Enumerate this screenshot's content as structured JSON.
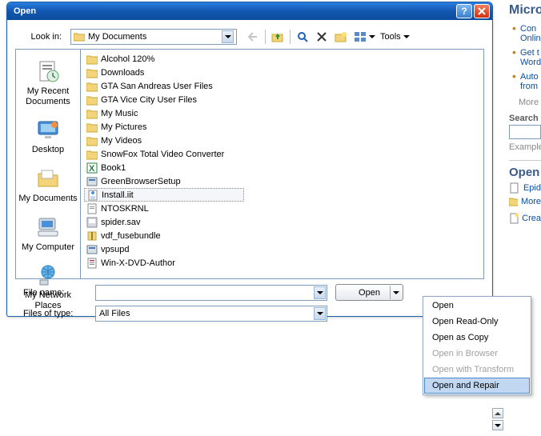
{
  "dialog": {
    "title": "Open",
    "lookin_label": "Look in:",
    "lookin_value": "My Documents",
    "tools_label": "Tools",
    "filename_label": "File name:",
    "filename_value": "",
    "filesoftype_label": "Files of type:",
    "filesoftype_value": "All Files",
    "open_button": "Open"
  },
  "places": [
    {
      "label": "My Recent Documents",
      "icon": "recent-docs-icon"
    },
    {
      "label": "Desktop",
      "icon": "desktop-icon"
    },
    {
      "label": "My Documents",
      "icon": "mydocs-icon"
    },
    {
      "label": "My Computer",
      "icon": "mycomputer-icon"
    },
    {
      "label": "My Network Places",
      "icon": "network-icon"
    }
  ],
  "files": [
    {
      "name": "Alcohol 120%",
      "type": "folder"
    },
    {
      "name": "Downloads",
      "type": "folder"
    },
    {
      "name": "GTA San Andreas User Files",
      "type": "folder"
    },
    {
      "name": "GTA Vice City User Files",
      "type": "folder"
    },
    {
      "name": "My Music",
      "type": "folder"
    },
    {
      "name": "My Pictures",
      "type": "folder"
    },
    {
      "name": "My Videos",
      "type": "folder"
    },
    {
      "name": "SnowFox Total Video Converter",
      "type": "folder"
    },
    {
      "name": "Book1",
      "type": "excel"
    },
    {
      "name": "GreenBrowserSetup",
      "type": "exe"
    },
    {
      "name": "Install.iit",
      "type": "iit",
      "selected": true
    },
    {
      "name": "NTOSKRNL",
      "type": "file"
    },
    {
      "name": "spider.sav",
      "type": "sav"
    },
    {
      "name": "vdf_fusebundle",
      "type": "zip"
    },
    {
      "name": "vpsupd",
      "type": "exe"
    },
    {
      "name": "Win-X-DVD-Author",
      "type": "richtext",
      "col2": true
    }
  ],
  "open_menu": {
    "items": [
      {
        "label": "Open",
        "enabled": true
      },
      {
        "label": "Open Read-Only",
        "enabled": true
      },
      {
        "label": "Open as Copy",
        "enabled": true
      },
      {
        "label": "Open in Browser",
        "enabled": false
      },
      {
        "label": "Open with Transform",
        "enabled": false
      },
      {
        "label": "Open and Repair",
        "enabled": true,
        "highlight": true
      }
    ]
  },
  "rightpane": {
    "heading1": "Micro",
    "bullets1": [
      {
        "line1": "Con",
        "line2": "Onlin"
      },
      {
        "line1": "Get t",
        "line2": "Word"
      },
      {
        "line1": "Auto",
        "line2": "from"
      }
    ],
    "more": "More",
    "search_label": "Search fo",
    "example": "Example",
    "heading2": "Open",
    "link1": "Epid",
    "link2": "More",
    "link3": "Crea"
  }
}
